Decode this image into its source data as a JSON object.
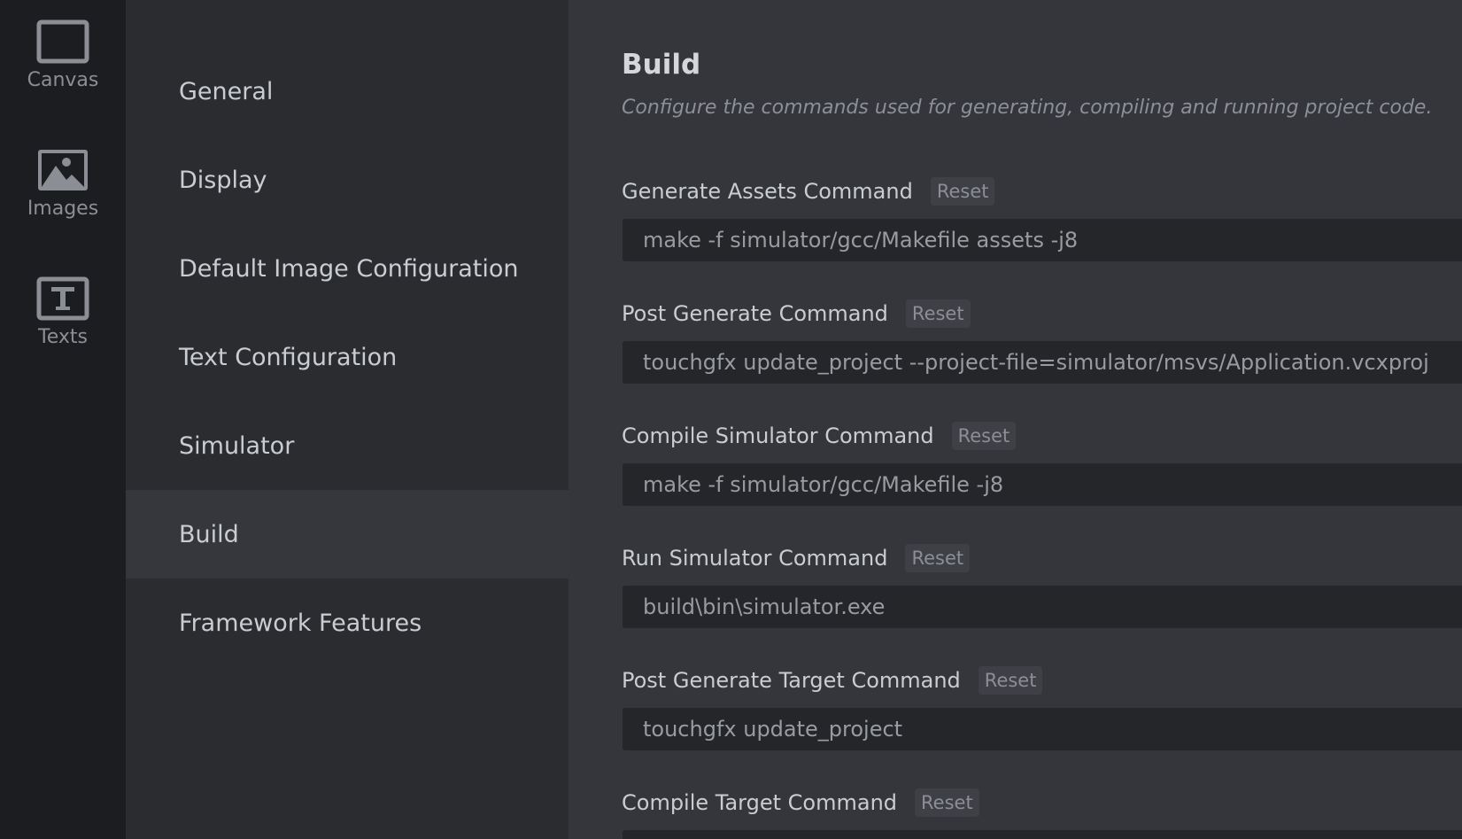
{
  "rail": {
    "items": [
      {
        "label": "Canvas",
        "icon": "canvas-icon"
      },
      {
        "label": "Images",
        "icon": "images-icon"
      },
      {
        "label": "Texts",
        "icon": "texts-icon"
      }
    ]
  },
  "nav": {
    "items": [
      {
        "label": "General"
      },
      {
        "label": "Display"
      },
      {
        "label": "Default Image Configuration"
      },
      {
        "label": "Text Configuration"
      },
      {
        "label": "Simulator"
      },
      {
        "label": "Build",
        "active": true
      },
      {
        "label": "Framework Features"
      }
    ]
  },
  "main": {
    "title": "Build",
    "subtitle": "Configure the commands used for generating, compiling and running project code.",
    "reset_label": "Reset",
    "fields": [
      {
        "label": "Generate Assets Command",
        "value": "make -f simulator/gcc/Makefile assets -j8"
      },
      {
        "label": "Post Generate Command",
        "value": "touchgfx update_project --project-file=simulator/msvs/Application.vcxproj"
      },
      {
        "label": "Compile Simulator Command",
        "value": "make -f simulator/gcc/Makefile -j8"
      },
      {
        "label": "Run Simulator Command",
        "value": "build\\bin\\simulator.exe"
      },
      {
        "label": "Post Generate Target Command",
        "value": "touchgfx update_project"
      },
      {
        "label": "Compile Target Command",
        "value": ""
      }
    ]
  },
  "colors": {
    "rail_bg": "#1c1d20",
    "nav_bg": "#2a2c30",
    "nav_active_bg": "#35373c",
    "main_bg": "#34363b",
    "input_bg": "#25262a"
  }
}
